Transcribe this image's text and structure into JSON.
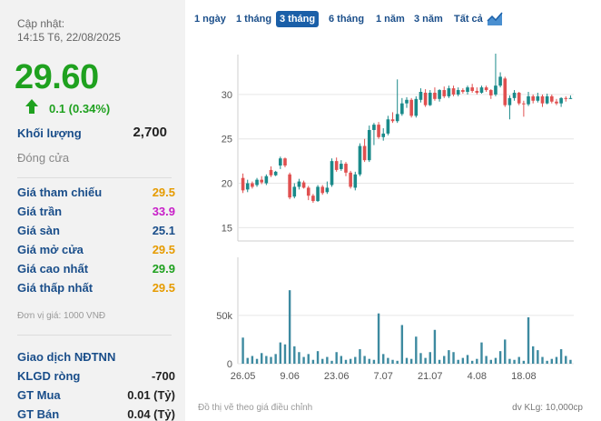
{
  "summary": {
    "update_label": "Cập nhật:",
    "update_time": "14:15 T6, 22/08/2025",
    "price": "29.60",
    "change": "0.1 (0.34%)",
    "volume_label": "Khối lượng",
    "volume_value": "2,700",
    "status": "Đóng cửa",
    "price_unit": "Đơn vị giá: 1000 VNĐ"
  },
  "prices": [
    {
      "label": "Giá tham chiếu",
      "value": "29.5",
      "color": "#e69b00"
    },
    {
      "label": "Giá trần",
      "value": "33.9",
      "color": "#c81ec8"
    },
    {
      "label": "Giá sàn",
      "value": "25.1",
      "color": "#1a4e8a"
    },
    {
      "label": "Giá mở cửa",
      "value": "29.5",
      "color": "#e69b00"
    },
    {
      "label": "Giá cao nhất",
      "value": "29.9",
      "color": "#1fa11f"
    },
    {
      "label": "Giá thấp nhất",
      "value": "29.5",
      "color": "#e69b00"
    }
  ],
  "foreign": {
    "title": "Giao dịch NĐTNN",
    "rows": [
      {
        "label": "KLGD ròng",
        "value": "-700"
      },
      {
        "label": "GT Mua",
        "value": "0.01 (Tỷ)"
      },
      {
        "label": "GT Bán",
        "value": "0.04 (Tỷ)"
      }
    ]
  },
  "tabs": [
    {
      "label": "1 ngày"
    },
    {
      "label": "1 tháng"
    },
    {
      "label": "3 tháng",
      "active": true
    },
    {
      "label": "6 tháng"
    },
    {
      "label": "1 năm"
    },
    {
      "label": "3 năm"
    },
    {
      "label": "Tất cả"
    }
  ],
  "footer": {
    "left": "Đồ thị vẽ theo giá điều chỉnh",
    "right": "dv KLg: 10,000cp"
  },
  "colors": {
    "up": "#1a8a8a",
    "down": "#e05050",
    "volume": "#3d8aa0"
  },
  "chart_data": {
    "type": "candlestick",
    "x_tick_labels": [
      "26.05",
      "9.06",
      "23.06",
      "7.07",
      "21.07",
      "4.08",
      "18.08"
    ],
    "price_ticks": [
      15,
      20,
      25,
      30
    ],
    "price_range": [
      13.5,
      34.5
    ],
    "volume_ticks": [
      0,
      50000
    ],
    "volume_tick_labels": [
      "0",
      "50k"
    ],
    "volume_max": 110000,
    "candles": [
      [
        20.6,
        19.2,
        21.1,
        18.9
      ],
      [
        19.3,
        20.0,
        20.4,
        19.0
      ],
      [
        20.0,
        19.6,
        20.2,
        19.4
      ],
      [
        19.8,
        20.4,
        20.6,
        19.6
      ],
      [
        20.4,
        20.1,
        20.8,
        19.9
      ],
      [
        20.0,
        20.8,
        21.0,
        19.8
      ],
      [
        21.5,
        20.9,
        21.9,
        20.7
      ],
      [
        20.9,
        21.3,
        21.4,
        20.8
      ],
      [
        22.0,
        22.8,
        23.0,
        21.6
      ],
      [
        22.8,
        22.0,
        22.9,
        21.8
      ],
      [
        21.0,
        18.4,
        21.2,
        18.2
      ],
      [
        18.5,
        19.6,
        20.0,
        18.3
      ],
      [
        19.6,
        20.2,
        20.5,
        19.3
      ],
      [
        20.1,
        19.5,
        20.3,
        19.4
      ],
      [
        19.5,
        18.6,
        19.7,
        18.1
      ],
      [
        18.6,
        18.0,
        18.8,
        17.8
      ],
      [
        18.0,
        19.6,
        19.8,
        17.9
      ],
      [
        19.6,
        18.9,
        19.8,
        18.7
      ],
      [
        19.0,
        19.5,
        20.2,
        18.8
      ],
      [
        19.8,
        22.5,
        22.8,
        19.6
      ],
      [
        22.5,
        21.5,
        22.9,
        21.3
      ],
      [
        21.6,
        22.2,
        22.6,
        21.4
      ],
      [
        22.2,
        21.2,
        22.4,
        20.8
      ],
      [
        21.2,
        19.6,
        21.4,
        19.4
      ],
      [
        19.5,
        21.0,
        21.3,
        19.2
      ],
      [
        21.0,
        24.2,
        24.5,
        20.8
      ],
      [
        24.2,
        22.6,
        25.0,
        22.4
      ],
      [
        22.6,
        26.0,
        26.5,
        22.4
      ],
      [
        26.0,
        26.6,
        26.8,
        24.3
      ],
      [
        26.6,
        25.2,
        26.9,
        25.0
      ],
      [
        25.2,
        25.6,
        26.2,
        24.8
      ],
      [
        25.6,
        27.2,
        27.6,
        25.4
      ],
      [
        27.2,
        27.0,
        28.0,
        26.8
      ],
      [
        27.0,
        27.8,
        31.7,
        26.8
      ],
      [
        27.8,
        29.0,
        29.6,
        27.6
      ],
      [
        29.0,
        29.4,
        29.7,
        28.5
      ],
      [
        29.4,
        27.6,
        29.6,
        27.4
      ],
      [
        27.6,
        29.5,
        29.8,
        27.4
      ],
      [
        29.4,
        30.3,
        30.7,
        29.1
      ],
      [
        30.2,
        28.8,
        30.6,
        28.6
      ],
      [
        28.8,
        30.2,
        30.5,
        28.7
      ],
      [
        30.2,
        29.5,
        30.8,
        29.3
      ],
      [
        29.5,
        30.5,
        30.6,
        29.2
      ],
      [
        30.5,
        29.8,
        30.9,
        29.6
      ],
      [
        29.8,
        30.7,
        31.0,
        29.6
      ],
      [
        30.7,
        30.0,
        31.0,
        29.8
      ],
      [
        30.0,
        30.5,
        30.8,
        29.8
      ],
      [
        30.5,
        30.3,
        30.7,
        30.1
      ],
      [
        30.3,
        30.8,
        31.0,
        30.0
      ],
      [
        30.8,
        30.4,
        31.2,
        30.2
      ],
      [
        30.4,
        30.2,
        30.8,
        30.0
      ],
      [
        30.2,
        30.8,
        31.0,
        30.1
      ],
      [
        30.8,
        30.5,
        31.0,
        30.3
      ],
      [
        30.5,
        29.9,
        30.6,
        29.5
      ],
      [
        30.0,
        31.0,
        34.6,
        29.8
      ],
      [
        31.0,
        32.0,
        32.5,
        30.8
      ],
      [
        31.8,
        28.8,
        32.0,
        28.6
      ],
      [
        28.8,
        29.6,
        29.9,
        27.2
      ],
      [
        29.6,
        30.2,
        30.5,
        29.3
      ],
      [
        30.2,
        29.0,
        30.3,
        28.8
      ],
      [
        29.0,
        28.9,
        29.3,
        27.5
      ],
      [
        28.9,
        29.8,
        30.3,
        28.7
      ],
      [
        29.8,
        29.3,
        30.0,
        29.0
      ],
      [
        29.3,
        29.8,
        30.2,
        29.1
      ],
      [
        29.8,
        29.0,
        30.0,
        28.6
      ],
      [
        29.0,
        29.8,
        30.1,
        28.9
      ],
      [
        29.8,
        29.2,
        30.0,
        29.0
      ],
      [
        29.2,
        29.0,
        29.5,
        28.8
      ],
      [
        29.0,
        29.6,
        29.7,
        28.6
      ],
      [
        29.6,
        29.5,
        29.8,
        29.2
      ],
      [
        29.5,
        29.6,
        29.9,
        29.5
      ]
    ],
    "volumes": [
      27000,
      6000,
      8000,
      5000,
      11000,
      8000,
      7000,
      10000,
      22000,
      20000,
      76000,
      18000,
      12000,
      7000,
      10000,
      4000,
      13000,
      5000,
      7000,
      3000,
      12000,
      8000,
      4000,
      5000,
      7000,
      15000,
      8000,
      5000,
      4000,
      52000,
      10000,
      6000,
      4000,
      3000,
      40000,
      6000,
      5000,
      28000,
      11000,
      6000,
      12000,
      35000,
      4000,
      8000,
      14000,
      12000,
      4000,
      6000,
      9000,
      3000,
      5000,
      22000,
      8000,
      4000,
      6000,
      13000,
      25000,
      5000,
      4000,
      7000,
      3000,
      48000,
      18000,
      14000,
      7000,
      3000,
      5000,
      7000,
      15000,
      8000,
      4000
    ]
  }
}
